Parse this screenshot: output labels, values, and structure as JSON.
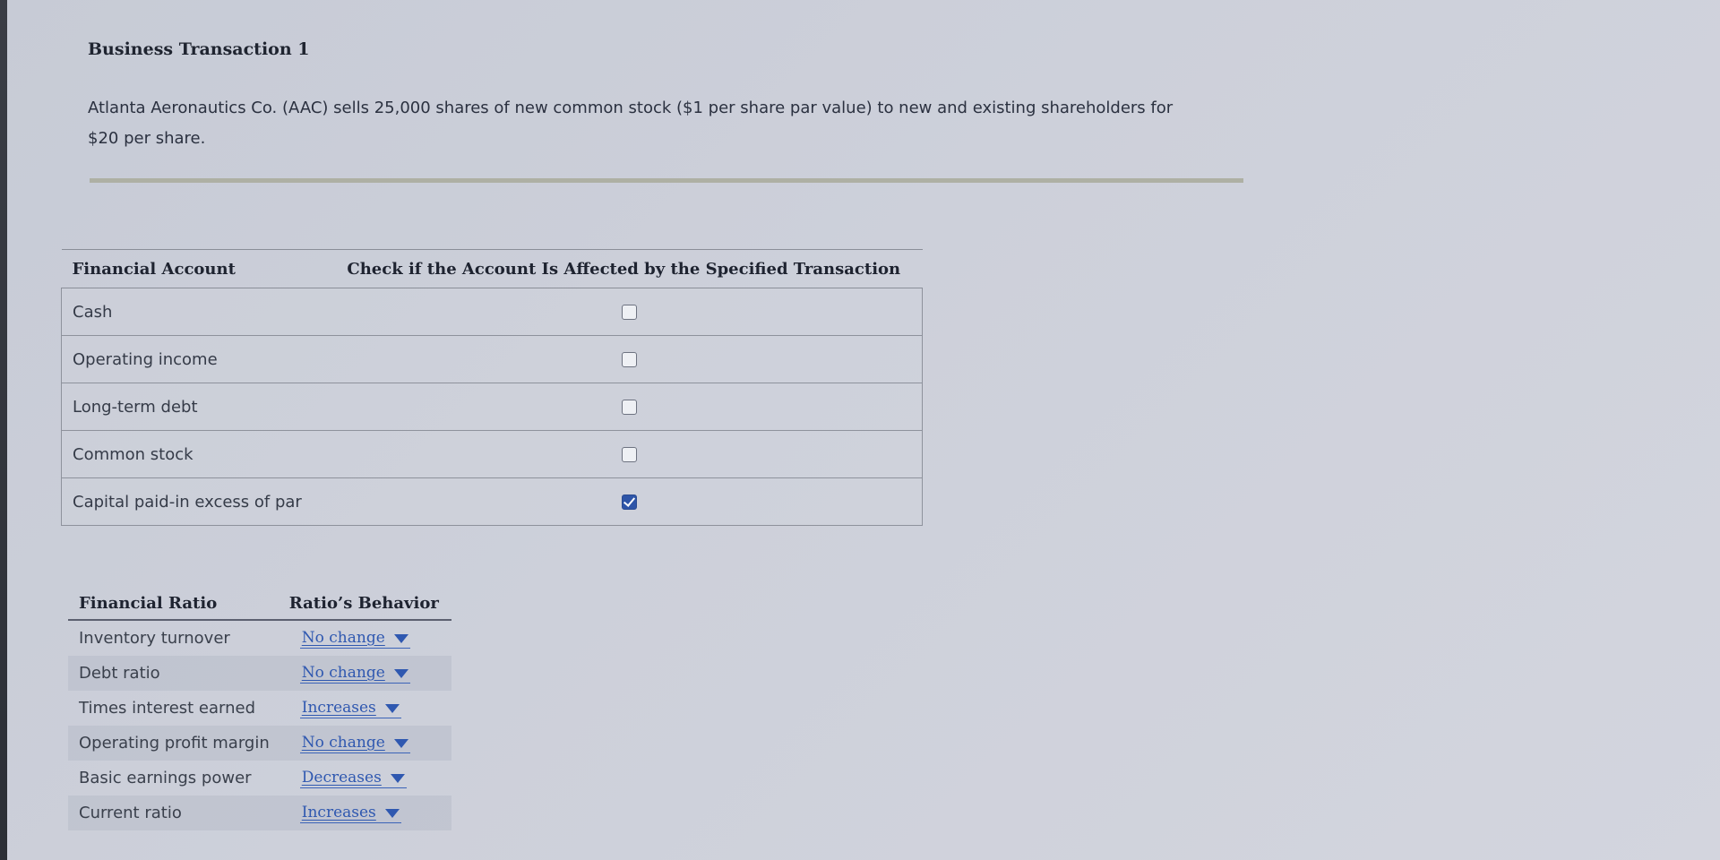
{
  "transaction": {
    "title": "Business Transaction 1",
    "description_line1": "Atlanta Aeronautics Co. (AAC) sells 25,000 shares of new common stock ($1 per share par value) to new and existing shareholders for",
    "description_line2": "$20 per share."
  },
  "accounts_table": {
    "header_account": "Financial Account",
    "header_check": "Check if the Account Is Affected by the Specified Transaction",
    "rows": [
      {
        "label": "Cash",
        "checked": false
      },
      {
        "label": "Operating income",
        "checked": false
      },
      {
        "label": "Long-term debt",
        "checked": false
      },
      {
        "label": "Common stock",
        "checked": false
      },
      {
        "label": "Capital paid-in excess of par",
        "checked": true
      }
    ]
  },
  "ratios_table": {
    "header_ratio": "Financial Ratio",
    "header_behavior": "Ratio’s Behavior",
    "rows": [
      {
        "label": "Inventory turnover",
        "behavior": "No change"
      },
      {
        "label": "Debt ratio",
        "behavior": "No change"
      },
      {
        "label": "Times interest earned",
        "behavior": "Increases"
      },
      {
        "label": "Operating profit margin",
        "behavior": "No change"
      },
      {
        "label": "Basic earnings power",
        "behavior": "Decreases"
      },
      {
        "label": "Current ratio",
        "behavior": "Increases"
      }
    ]
  },
  "colors": {
    "link_blue": "#2f58b0",
    "checkbox_checked": "#2e55a8"
  },
  "icons": {
    "dropdown": "caret-down-icon",
    "check": "checkmark-icon"
  }
}
